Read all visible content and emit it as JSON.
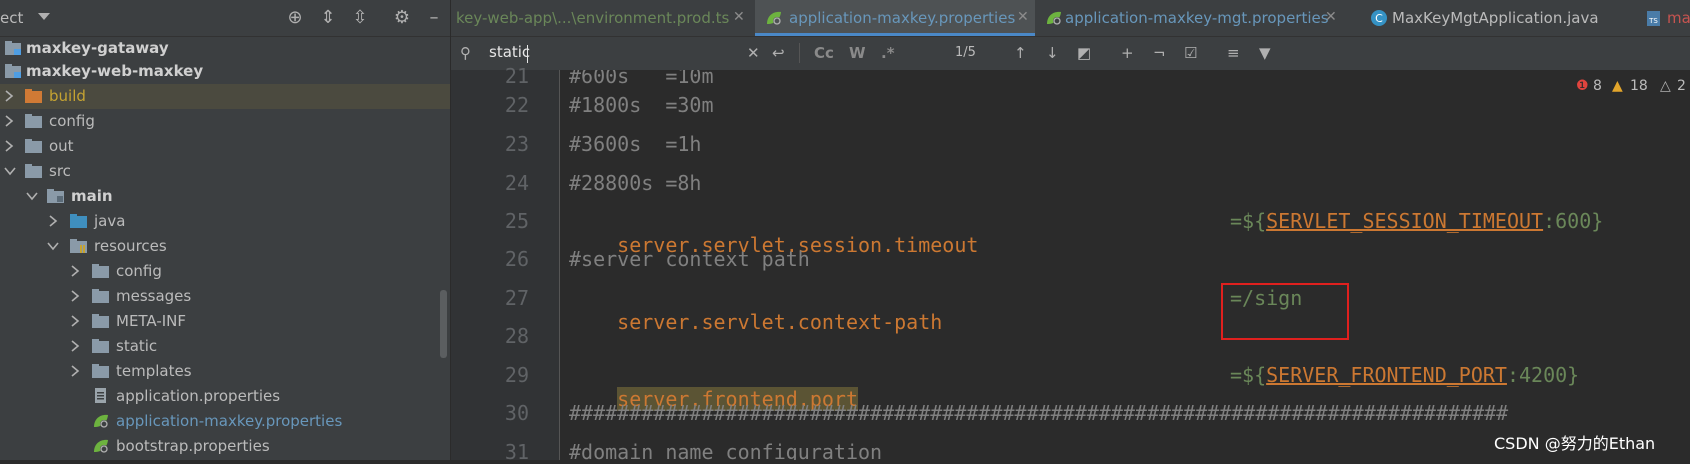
{
  "sidebar": {
    "header_label": "ect",
    "items": [
      {
        "label": "maxkey-gataway",
        "bold": true
      },
      {
        "label": "maxkey-web-maxkey",
        "bold": true
      },
      {
        "label": "build"
      },
      {
        "label": "config"
      },
      {
        "label": "out"
      },
      {
        "label": "src"
      },
      {
        "label": "main",
        "bold": true
      },
      {
        "label": "java"
      },
      {
        "label": "resources"
      },
      {
        "label": "config"
      },
      {
        "label": "messages"
      },
      {
        "label": "META-INF"
      },
      {
        "label": "static"
      },
      {
        "label": "templates"
      },
      {
        "label": "application.properties"
      },
      {
        "label": "application-maxkey.properties"
      },
      {
        "label": "bootstrap.properties"
      }
    ]
  },
  "tabs": [
    {
      "label": "key-web-app\\...\\environment.prod.ts"
    },
    {
      "label": "application-maxkey.properties",
      "active": true
    },
    {
      "label": "application-maxkey-mgt.properties"
    },
    {
      "label": "MaxKeyMgtApplication.java"
    },
    {
      "label": "ma"
    }
  ],
  "find": {
    "query": "static",
    "opt_case": "Cc",
    "opt_word": "W",
    "opt_regex": ".*",
    "match_count": "1/5"
  },
  "inspections": {
    "errors": "8",
    "warnings": "18",
    "weak": "2"
  },
  "editor": {
    "line_numbers": [
      "21",
      "22",
      "23",
      "24",
      "25",
      "26",
      "27",
      "28",
      "29",
      "30",
      "31"
    ],
    "lines": {
      "l21": "#600s   =10m",
      "l22": "#1800s  =30m",
      "l23": "#3600s  =1h",
      "l24": "#28800s =8h",
      "l25_key": "server.servlet.session.timeout",
      "l25_eq": "=${",
      "l25_ph": "SERVLET_SESSION_TIMEOUT",
      "l25_def": ":600}",
      "l26": "#server context path",
      "l27_key": "server.servlet.context-path",
      "l27_val": "=/sign",
      "l29_key": "server.frontend.port",
      "l29_eq": "=${",
      "l29_ph": "SERVER_FRONTEND_PORT",
      "l29_def": ":4200}",
      "l30": "##############################################################################",
      "l31": "#domain name configuration"
    }
  },
  "watermark": "CSDN @努力的Ethan",
  "colors": {
    "keyword": "#cc7832",
    "value": "#6a8759",
    "comment": "#808080",
    "highlight": "#5b5434",
    "red_box": "#e0201e"
  }
}
